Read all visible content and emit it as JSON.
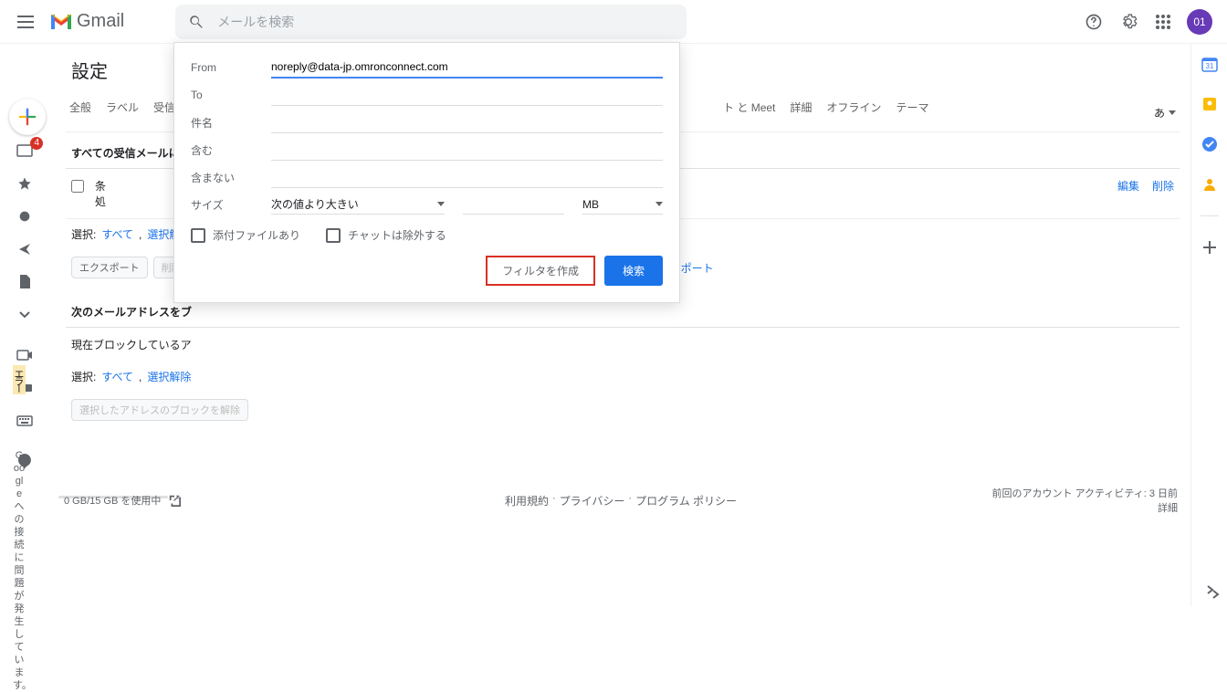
{
  "header": {
    "logo_letters": [
      "M",
      "G"
    ]
  },
  "search": {
    "placeholder": "メールを検索"
  },
  "avatar": {
    "initial": "01"
  },
  "settings": {
    "title": "設定",
    "tabs": [
      "全般",
      "ラベル",
      "受信トレ",
      "",
      "",
      "ト と Meet",
      "詳細",
      "オフライン",
      "テーマ"
    ],
    "lang_sel": "あ"
  },
  "sections": {
    "filters_title": "すべての受信メールに次の",
    "filter_row": {
      "cond_label": "条",
      "action_label": "処"
    },
    "row_edit": "編集",
    "row_delete": "削除",
    "select_label": "選択:",
    "select_all": "すべて",
    "select_none": "選択解除",
    "export_btn": "エクスポート",
    "delete_btn": "削除",
    "import_link": "ンポート",
    "blocked_title": "次のメールアドレスをブ",
    "blocked_desc": "現在ブロックしているア",
    "unblock_btn": "選択したアドレスのブロックを解除"
  },
  "sidebar": {
    "badge": "4",
    "error_pill": "エラー",
    "google_msg": "Google への接続に問題が発生しています。"
  },
  "footer": {
    "storage": "0 GB/15 GB を使用中",
    "terms": "利用規約",
    "privacy": "プライバシー",
    "policies": "プログラム ポリシー",
    "activity": "前回のアカウント アクティビティ: 3 日前",
    "details": "詳細"
  },
  "popup": {
    "from_label": "From",
    "from_value": "noreply@data-jp.omronconnect.com",
    "to_label": "To",
    "subject_label": "件名",
    "has_label": "含む",
    "nothas_label": "含まない",
    "size_label": "サイズ",
    "size_op": "次の値より大きい",
    "size_unit": "MB",
    "has_attach": "添付ファイルあり",
    "exclude_chat": "チャットは除外する",
    "create_filter": "フィルタを作成",
    "search_btn": "検索"
  }
}
